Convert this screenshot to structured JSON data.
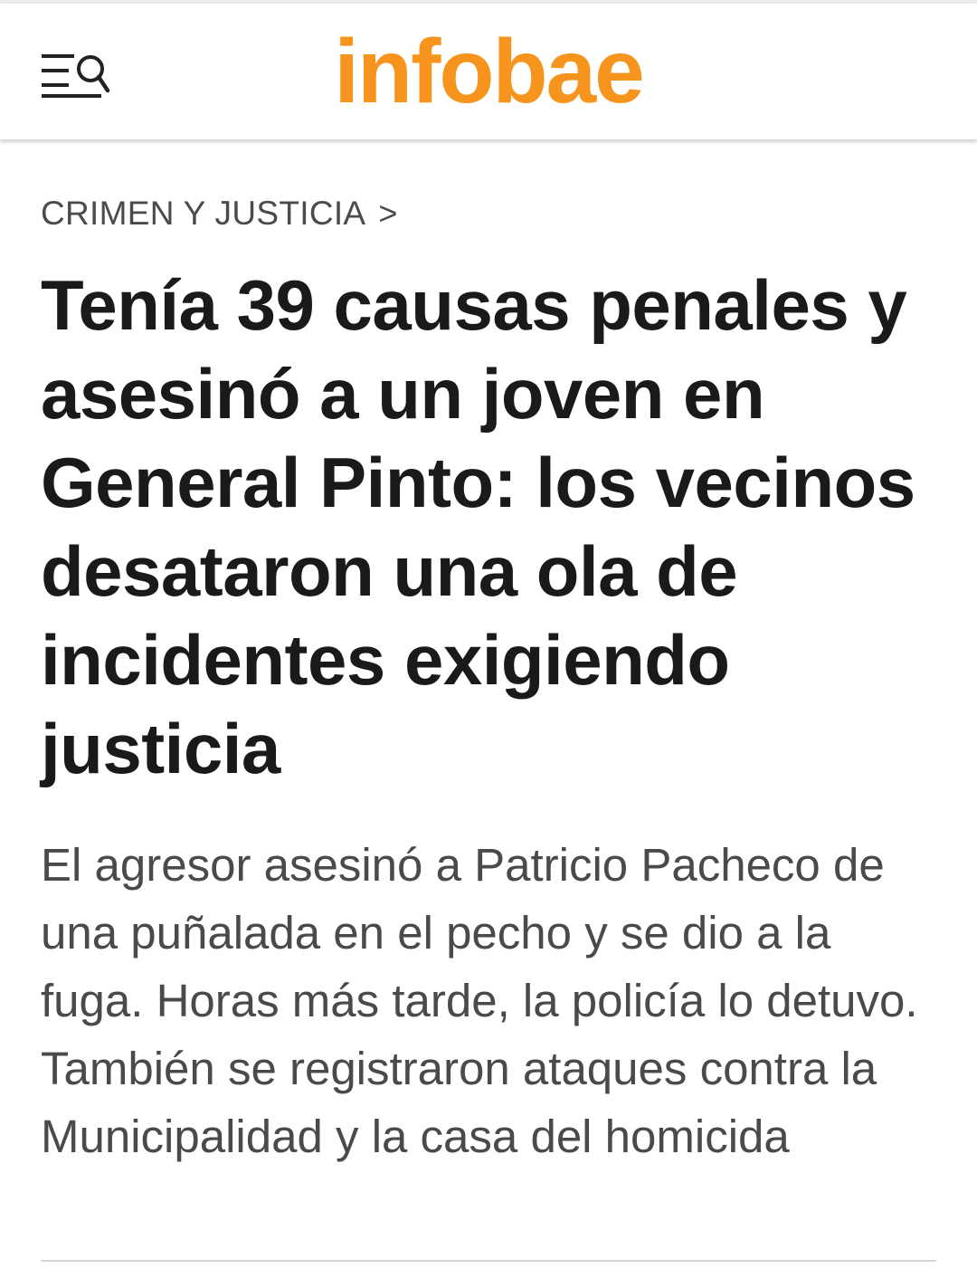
{
  "header": {
    "logo_text": "infobae",
    "logo_color": "#f7941d",
    "menu_icon": "menu-search-icon"
  },
  "article": {
    "section": "CRIMEN Y JUSTICIA",
    "section_chevron": ">",
    "headline": "Tenía 39 causas penales y asesinó a un joven en General Pinto: los vecinos desataron una ola de incidentes exigiendo justicia",
    "subheadline": "El agresor asesinó a Patricio Pacheco de una puñalada en el pecho y se dio a la fuga. Horas más tarde, la policía lo detuvo. También se registraron ataques contra la Municipalidad y la casa del homicida"
  }
}
